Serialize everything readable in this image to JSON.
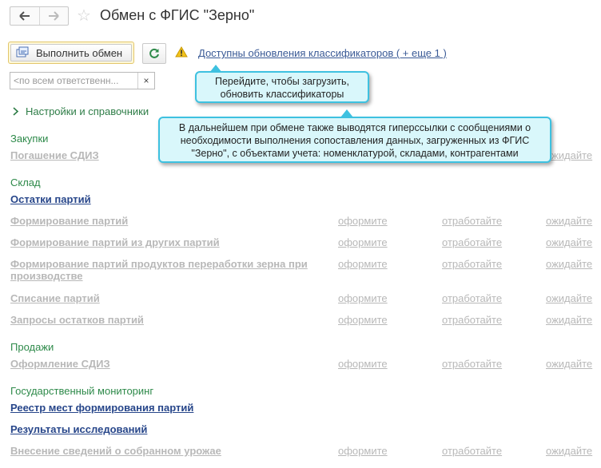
{
  "window": {
    "title": "Обмен с ФГИС \"Зерно\""
  },
  "nav": {
    "back_glyph": "🡐",
    "forward_glyph": "🡒"
  },
  "toolbar": {
    "exec_label": "Выполнить обмен",
    "updates_link": "Доступны обновления классификаторов ( + еще 1 )"
  },
  "search": {
    "placeholder": "<по всем ответственн...",
    "clear_glyph": "×"
  },
  "settings": {
    "label": "Настройки и справочники"
  },
  "groups": {
    "purchases": "Закупки",
    "warehouse": "Склад",
    "sales": "Продажи",
    "monitoring": "Государственный мониторинг"
  },
  "actions": {
    "register": "оформите",
    "process": "отработайте",
    "wait": "ожидайте"
  },
  "items": {
    "sdiz_repay": "Погашение СДИЗ",
    "lot_balances": "Остатки партий",
    "lot_forming": "Формирование партий",
    "lot_forming_other": "Формирование партий из других партий",
    "lot_forming_processing_1": "Формирование партий продуктов переработки зерна при",
    "lot_forming_processing_2": "производстве",
    "lot_writeoff": "Списание партий",
    "balance_requests": "Запросы остатков партий",
    "sdiz_issue": "Оформление СДИЗ",
    "places_registry": "Реестр мест формирования партий",
    "research_results": "Результаты исследований",
    "harvest_info": "Внесение сведений о собранном урожае"
  },
  "callouts": {
    "first_1": "Перейдите, чтобы загрузить,",
    "first_2": "обновить классификаторы",
    "second_1": "В дальнейшем при обмене также выводятся гиперссылки с сообщениями о",
    "second_2": "необходимости выполнения сопоставления данных, загруженных из ФГИС",
    "second_3": "\"Зерно\", с объектами учета: номенклатурой, складами, контрагентами"
  },
  "colors": {
    "accent_green": "#2e8a4a",
    "link_blue": "#27468a",
    "disabled_grey": "#b8b8b8",
    "callout_fill": "#d9f7fb",
    "callout_border": "#3ec1e0"
  }
}
